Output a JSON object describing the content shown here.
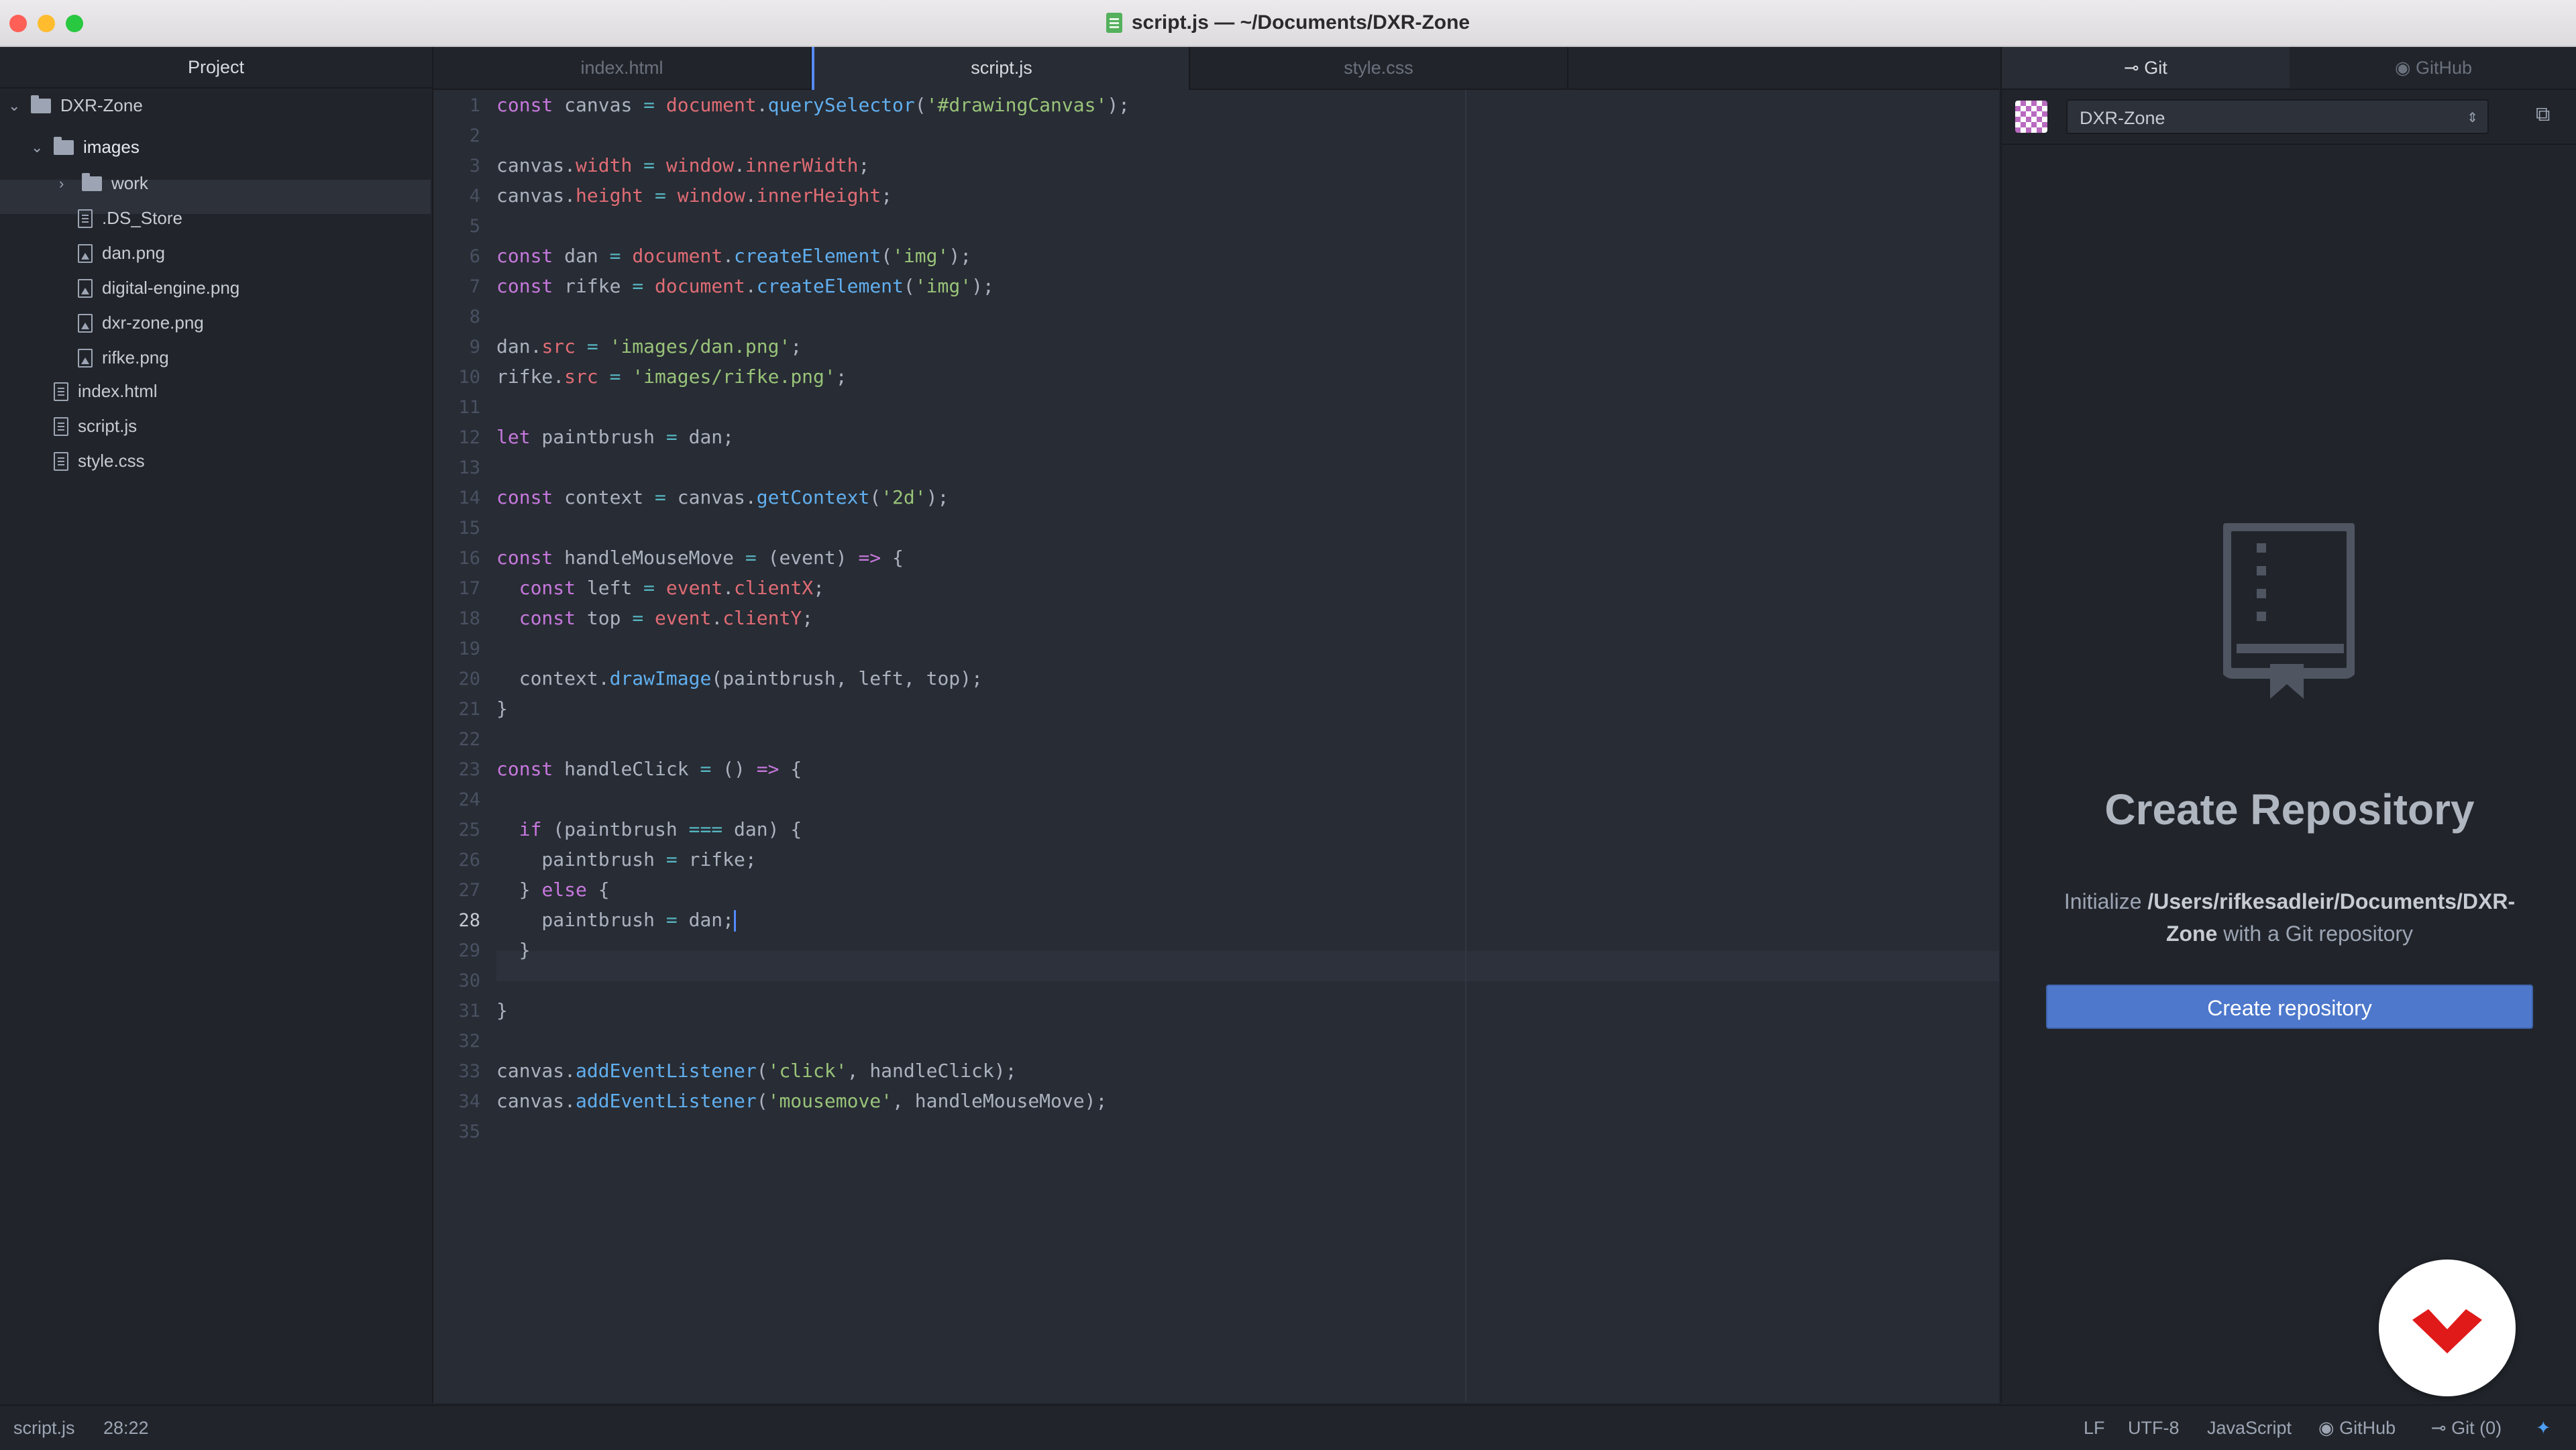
{
  "window": {
    "title": "script.js — ~/Documents/DXR-Zone"
  },
  "tree": {
    "header": "Project",
    "items": [
      {
        "label": "DXR-Zone",
        "type": "folder",
        "expanded": true
      },
      {
        "label": "images",
        "type": "folder",
        "expanded": true,
        "selected": true
      },
      {
        "label": "work",
        "type": "folder",
        "expanded": false
      },
      {
        "label": ".DS_Store",
        "type": "file"
      },
      {
        "label": "dan.png",
        "type": "image"
      },
      {
        "label": "digital-engine.png",
        "type": "image"
      },
      {
        "label": "dxr-zone.png",
        "type": "image"
      },
      {
        "label": "rifke.png",
        "type": "image"
      },
      {
        "label": "index.html",
        "type": "file"
      },
      {
        "label": "script.js",
        "type": "file"
      },
      {
        "label": "style.css",
        "type": "file"
      }
    ]
  },
  "tabs": [
    {
      "label": "index.html",
      "active": false
    },
    {
      "label": "script.js",
      "active": true
    },
    {
      "label": "style.css",
      "active": false
    }
  ],
  "code": {
    "cursor_line": 28,
    "lines": [
      [
        [
          "k",
          "const"
        ],
        [
          "t",
          " canvas "
        ],
        [
          "o",
          "="
        ],
        [
          "t",
          " "
        ],
        [
          "v",
          "document"
        ],
        [
          "t",
          "."
        ],
        [
          "f",
          "querySelector"
        ],
        [
          "t",
          "("
        ],
        [
          "s",
          "'#drawingCanvas'"
        ],
        [
          "t",
          ");"
        ]
      ],
      [],
      [
        [
          "t",
          "canvas."
        ],
        [
          "v",
          "width"
        ],
        [
          "t",
          " "
        ],
        [
          "o",
          "="
        ],
        [
          "t",
          " "
        ],
        [
          "v",
          "window"
        ],
        [
          "t",
          "."
        ],
        [
          "v",
          "innerWidth"
        ],
        [
          "t",
          ";"
        ]
      ],
      [
        [
          "t",
          "canvas."
        ],
        [
          "v",
          "height"
        ],
        [
          "t",
          " "
        ],
        [
          "o",
          "="
        ],
        [
          "t",
          " "
        ],
        [
          "v",
          "window"
        ],
        [
          "t",
          "."
        ],
        [
          "v",
          "innerHeight"
        ],
        [
          "t",
          ";"
        ]
      ],
      [],
      [
        [
          "k",
          "const"
        ],
        [
          "t",
          " dan "
        ],
        [
          "o",
          "="
        ],
        [
          "t",
          " "
        ],
        [
          "v",
          "document"
        ],
        [
          "t",
          "."
        ],
        [
          "f",
          "createElement"
        ],
        [
          "t",
          "("
        ],
        [
          "s",
          "'img'"
        ],
        [
          "t",
          ");"
        ]
      ],
      [
        [
          "k",
          "const"
        ],
        [
          "t",
          " rifke "
        ],
        [
          "o",
          "="
        ],
        [
          "t",
          " "
        ],
        [
          "v",
          "document"
        ],
        [
          "t",
          "."
        ],
        [
          "f",
          "createElement"
        ],
        [
          "t",
          "("
        ],
        [
          "s",
          "'img'"
        ],
        [
          "t",
          ");"
        ]
      ],
      [],
      [
        [
          "t",
          "dan."
        ],
        [
          "v",
          "src"
        ],
        [
          "t",
          " "
        ],
        [
          "o",
          "="
        ],
        [
          "t",
          " "
        ],
        [
          "s",
          "'images/dan.png'"
        ],
        [
          "t",
          ";"
        ]
      ],
      [
        [
          "t",
          "rifke."
        ],
        [
          "v",
          "src"
        ],
        [
          "t",
          " "
        ],
        [
          "o",
          "="
        ],
        [
          "t",
          " "
        ],
        [
          "s",
          "'images/rifke.png'"
        ],
        [
          "t",
          ";"
        ]
      ],
      [],
      [
        [
          "k",
          "let"
        ],
        [
          "t",
          " paintbrush "
        ],
        [
          "o",
          "="
        ],
        [
          "t",
          " dan;"
        ]
      ],
      [],
      [
        [
          "k",
          "const"
        ],
        [
          "t",
          " context "
        ],
        [
          "o",
          "="
        ],
        [
          "t",
          " canvas."
        ],
        [
          "f",
          "getContext"
        ],
        [
          "t",
          "("
        ],
        [
          "s",
          "'2d'"
        ],
        [
          "t",
          ");"
        ]
      ],
      [],
      [
        [
          "k",
          "const"
        ],
        [
          "t",
          " handleMouseMove "
        ],
        [
          "o",
          "="
        ],
        [
          "t",
          " (event) "
        ],
        [
          "k",
          "=>"
        ],
        [
          "t",
          " {"
        ]
      ],
      [
        [
          "t",
          "  "
        ],
        [
          "k",
          "const"
        ],
        [
          "t",
          " left "
        ],
        [
          "o",
          "="
        ],
        [
          "t",
          " "
        ],
        [
          "v",
          "event"
        ],
        [
          "t",
          "."
        ],
        [
          "v",
          "clientX"
        ],
        [
          "t",
          ";"
        ]
      ],
      [
        [
          "t",
          "  "
        ],
        [
          "k",
          "const"
        ],
        [
          "t",
          " top "
        ],
        [
          "o",
          "="
        ],
        [
          "t",
          " "
        ],
        [
          "v",
          "event"
        ],
        [
          "t",
          "."
        ],
        [
          "v",
          "clientY"
        ],
        [
          "t",
          ";"
        ]
      ],
      [],
      [
        [
          "t",
          "  context."
        ],
        [
          "f",
          "drawImage"
        ],
        [
          "t",
          "(paintbrush, left, top);"
        ]
      ],
      [
        [
          "t",
          "}"
        ]
      ],
      [],
      [
        [
          "k",
          "const"
        ],
        [
          "t",
          " handleClick "
        ],
        [
          "o",
          "="
        ],
        [
          "t",
          " () "
        ],
        [
          "k",
          "=>"
        ],
        [
          "t",
          " {"
        ]
      ],
      [],
      [
        [
          "t",
          "  "
        ],
        [
          "k",
          "if"
        ],
        [
          "t",
          " (paintbrush "
        ],
        [
          "o",
          "==="
        ],
        [
          "t",
          " dan) {"
        ]
      ],
      [
        [
          "t",
          "    paintbrush "
        ],
        [
          "o",
          "="
        ],
        [
          "t",
          " rifke;"
        ]
      ],
      [
        [
          "t",
          "  } "
        ],
        [
          "k",
          "else"
        ],
        [
          "t",
          " {"
        ]
      ],
      [
        [
          "t",
          "    paintbrush "
        ],
        [
          "o",
          "="
        ],
        [
          "t",
          " dan;"
        ]
      ],
      [
        [
          "t",
          "  }"
        ]
      ],
      [],
      [
        [
          "t",
          "}"
        ]
      ],
      [],
      [
        [
          "t",
          "canvas."
        ],
        [
          "f",
          "addEventListener"
        ],
        [
          "t",
          "("
        ],
        [
          "s",
          "'click'"
        ],
        [
          "t",
          ", handleClick);"
        ]
      ],
      [
        [
          "t",
          "canvas."
        ],
        [
          "f",
          "addEventListener"
        ],
        [
          "t",
          "("
        ],
        [
          "s",
          "'mousemove'"
        ],
        [
          "t",
          ", handleMouseMove);"
        ]
      ],
      []
    ]
  },
  "git": {
    "tabs": [
      {
        "label": "Git",
        "active": true
      },
      {
        "label": "GitHub",
        "active": false
      }
    ],
    "repo": "DXR-Zone",
    "title": "Create Repository",
    "desc_prefix": "Initialize ",
    "desc_path": "/Users/rifkesadleir/Documents/DXR-Zone",
    "desc_suffix": " with a Git repository",
    "button": "Create repository"
  },
  "status": {
    "file": "script.js",
    "position": "28:22",
    "line_ending": "LF",
    "encoding": "UTF-8",
    "grammar": "JavaScript",
    "github": "GitHub",
    "git": "Git (0)"
  },
  "colors": {
    "accent": "#4d78cc",
    "badge_red": "#e01919"
  }
}
